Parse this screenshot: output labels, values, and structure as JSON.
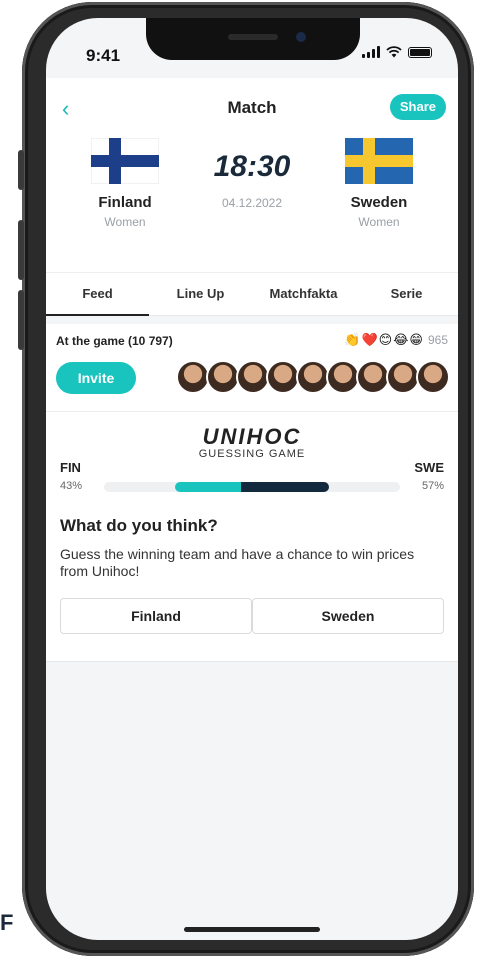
{
  "status_bar": {
    "time": "9:41"
  },
  "nav": {
    "title": "Match",
    "back_icon": "chevron-left",
    "share_label": "Share"
  },
  "match": {
    "home": {
      "name": "Finland",
      "category": "Women",
      "flag": "finland-flag"
    },
    "away": {
      "name": "Sweden",
      "category": "Women",
      "flag": "sweden-flag"
    },
    "time": "18:30",
    "date": "04.12.2022"
  },
  "tabs": [
    {
      "label": "Feed",
      "active": true
    },
    {
      "label": "Line Up",
      "active": false
    },
    {
      "label": "Matchfakta",
      "active": false
    },
    {
      "label": "Serie",
      "active": false
    }
  ],
  "attendance": {
    "label": "At the game (10 797)",
    "reaction_icons": [
      "👏",
      "❤️",
      "😊",
      "😂",
      "😁"
    ],
    "reaction_count": "965",
    "invite_label": "Invite",
    "avatar_count": 9
  },
  "guessing_game": {
    "brand": "UNIHOC",
    "brand_sub": "GUESSING GAME",
    "home_code": "FIN",
    "away_code": "SWE",
    "home_pct_label": "43%",
    "away_pct_label": "57%",
    "home_fraction": 0.43,
    "away_fraction": 0.57,
    "question": "What do you think?",
    "description": "Guess the winning team and have a chance to win prices from Unihoc!",
    "home_button": "Finland",
    "away_button": "Sweden"
  },
  "colors": {
    "accent": "#19c4bf",
    "dark_bar": "#13293d",
    "text": "#222222",
    "muted": "#9aa0a6"
  },
  "page_corner_letter": "F"
}
